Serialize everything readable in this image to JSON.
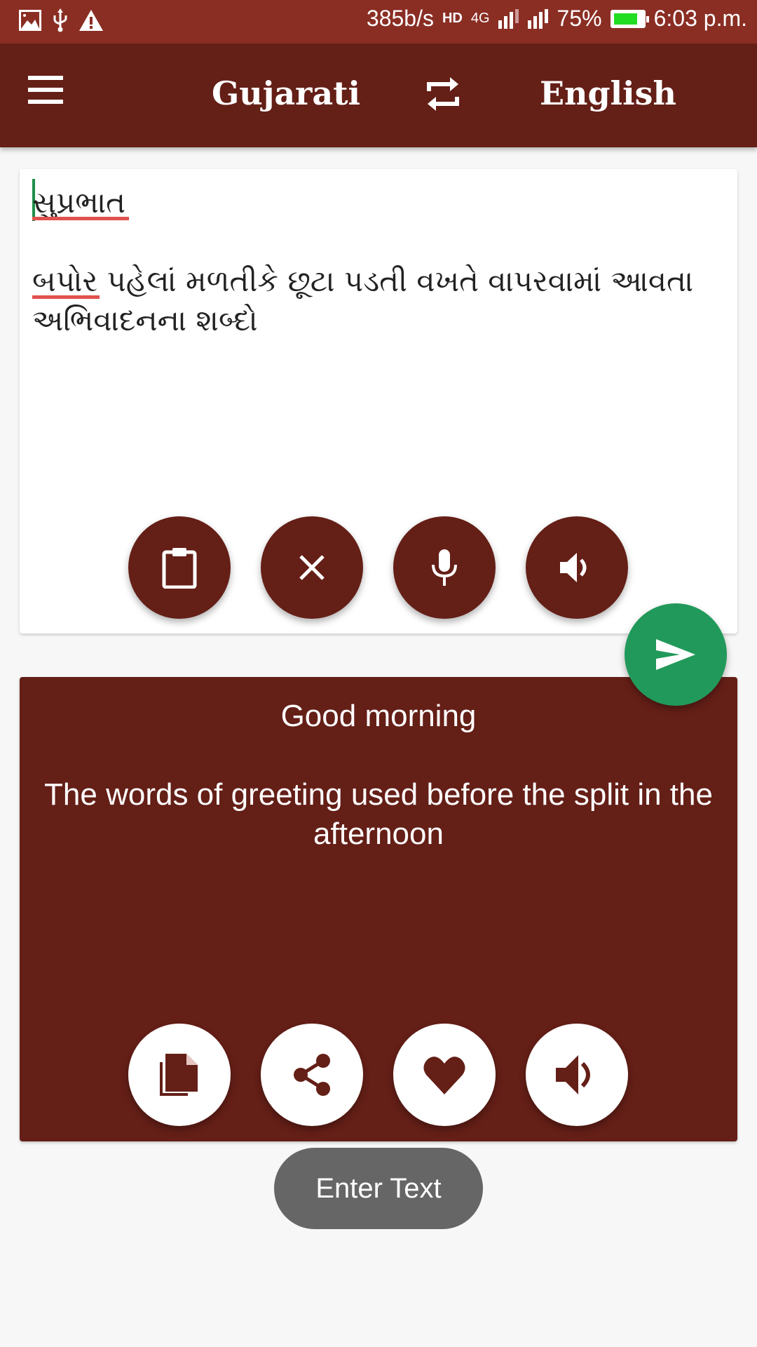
{
  "status_bar": {
    "left_icons": [
      "image-icon",
      "usb-icon",
      "warning-icon"
    ],
    "network_speed": "385b/s",
    "hd_label": "HD",
    "network_type": "4G",
    "battery_percent": "75%",
    "battery_level": 0.75,
    "time": "6:03 p.m."
  },
  "app_bar": {
    "source_language": "Gujarati",
    "target_language": "English",
    "menu_icon": "menu-icon",
    "swap_icon": "swap-icon"
  },
  "input": {
    "text": "સુપ્રભાત\n\nબપોર પહેલાં મળતીકે છૂટા પડતી વખતે વાપરવામાં આવતા અભિવાદનના શબ્દો",
    "actions": [
      {
        "name": "paste",
        "icon": "clipboard-icon"
      },
      {
        "name": "clear",
        "icon": "close-icon"
      },
      {
        "name": "voice-input",
        "icon": "microphone-icon"
      },
      {
        "name": "speak-input",
        "icon": "speaker-icon"
      }
    ]
  },
  "translate_button": {
    "icon": "send-icon",
    "color": "#21995a"
  },
  "output": {
    "text": "Good morning\n\nThe words of greeting used before the split in the afternoon",
    "actions": [
      {
        "name": "copy",
        "icon": "copy-icon"
      },
      {
        "name": "share",
        "icon": "share-icon"
      },
      {
        "name": "favorite",
        "icon": "heart-icon"
      },
      {
        "name": "speak-output",
        "icon": "speaker-icon"
      }
    ]
  },
  "toast": {
    "text": "Enter Text"
  },
  "colors": {
    "status_bar": "#8a2e24",
    "primary": "#641f17",
    "accent": "#21995a",
    "background": "#f7f7f7"
  }
}
